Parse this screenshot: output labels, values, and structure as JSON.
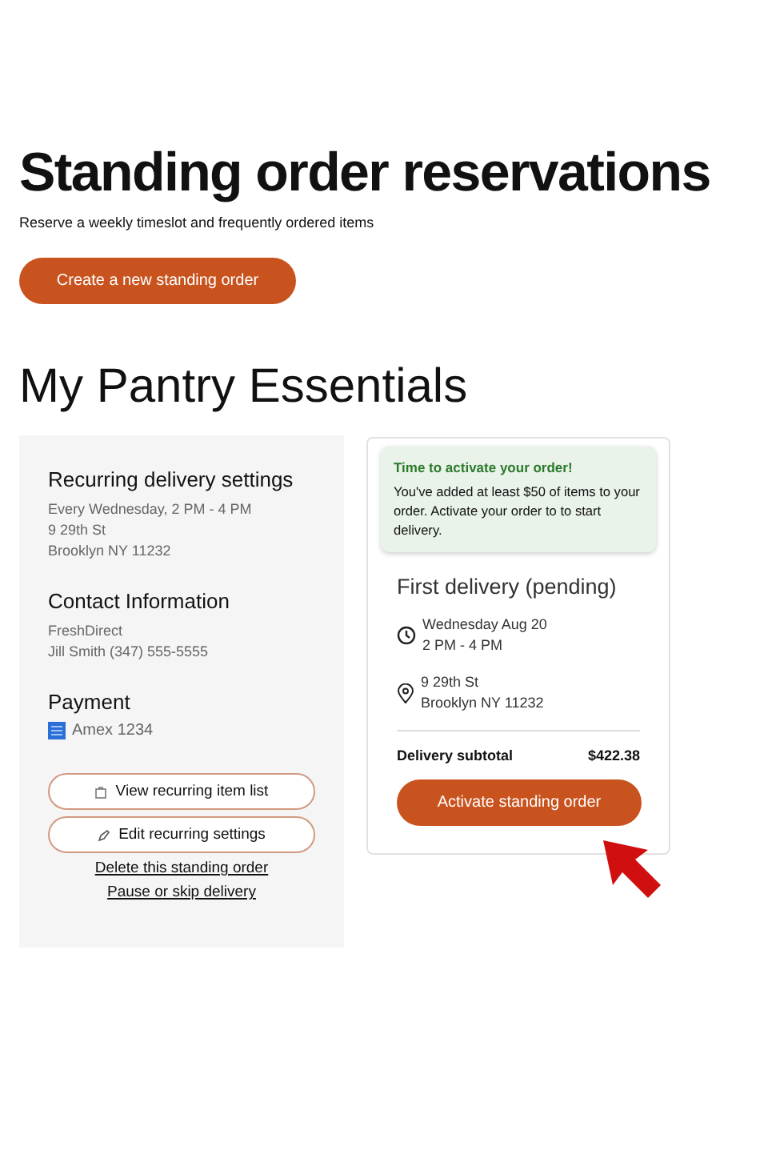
{
  "header": {
    "title": "Standing order reservations",
    "subtitle": "Reserve a weekly timeslot and frequently ordered items",
    "create_button": "Create a new standing order"
  },
  "order": {
    "name": "My Pantry Essentials",
    "settings": [
      {
        "heading": "Recurring delivery settings",
        "lines": [
          "Every Wednesday, 2 PM - 4 PM",
          "9 29th St",
          "Brooklyn NY 11232"
        ]
      },
      {
        "heading": "Contact Information",
        "lines": [
          "FreshDirect",
          "Jill Smith (347) 555-5555"
        ]
      }
    ],
    "payment": {
      "heading": "Payment",
      "card": "Amex 1234"
    },
    "actions": [
      {
        "label": "View recurring item list",
        "kind": "list"
      },
      {
        "label": "Edit recurring settings",
        "kind": "edit"
      }
    ],
    "links": [
      "Delete this standing order",
      "Pause or skip delivery"
    ]
  },
  "delivery": {
    "notice": {
      "title": "Time to activate your order!",
      "text": "You've added at least $50 of items to your order. Activate your order to to start delivery."
    },
    "heading": "First delivery (pending)",
    "details": [
      {
        "kind": "time",
        "lines": [
          "Wednesday Aug 20",
          "2 PM - 4 PM"
        ]
      },
      {
        "kind": "place",
        "lines": [
          "9 29th St",
          "Brooklyn NY 11232"
        ]
      }
    ],
    "subtotal_label": "Delivery subtotal",
    "subtotal": "$422.38",
    "activate_button": "Activate standing order"
  }
}
